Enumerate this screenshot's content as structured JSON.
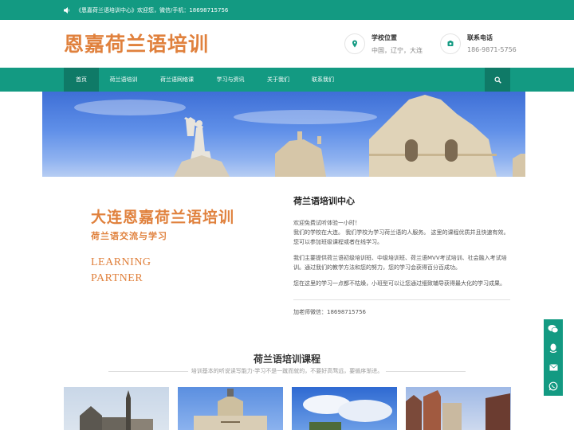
{
  "topbar": {
    "notice": "《恩嘉荷兰语培训中心》欢迎您，微信/手机：18698715756",
    "icon": "speaker-icon"
  },
  "header": {
    "logo": "恩嘉荷兰语培训",
    "location": {
      "label": "学校位置",
      "value": "中国，辽宁，大连",
      "icon": "map-pin-icon"
    },
    "phone": {
      "label": "联系电话",
      "value": "186-9871-5756",
      "icon": "phone-icon"
    }
  },
  "nav": {
    "items": [
      {
        "label": "首页"
      },
      {
        "label": "荷兰语培训"
      },
      {
        "label": "荷兰语网络课"
      },
      {
        "label": "学习与资讯"
      },
      {
        "label": "关于我们"
      },
      {
        "label": "联系我们"
      }
    ],
    "active_index": 0,
    "search_icon": "search-icon"
  },
  "intro_image": {
    "headline": "大连恩嘉荷兰语培训",
    "subline": "荷兰语交流与学习",
    "english_line1": "LEARNING",
    "english_line2": "PARTNER"
  },
  "intro": {
    "title": "荷兰语培训中心",
    "p1_line1": "欢迎免费试听体验一小时！",
    "p1_line2": "我们的学校在大连。 我们学校为学习荷兰语的人服务。 这里的课程优质并且快速有效。您可以参加班级课程或者在线学习。",
    "p2": "我们主要提供荷兰语初级培训班、中级培训班、荷兰语MVV考试培训、社会融入考试培训。通过我们的教学方法和您的努力，您的学习会获得百分百成功。",
    "p3": "您在这里的学习一点都不枯燥，小班型可以让您通过细致辅导获得最大化的学习成果。",
    "wechat": "加老师微信：18698715756"
  },
  "courses": {
    "title": "荷兰语培训课程",
    "subtitle": "培训基本的听说读写能力-学习不是一蹴而就的，不要好高骛远，要循序渐进。"
  },
  "side_buttons": [
    "wechat-icon",
    "qq-icon",
    "mail-icon",
    "whatsapp-icon"
  ],
  "colors": {
    "primary": "#139a82",
    "primary_dark": "#0f7a67",
    "accent": "#e0813d"
  }
}
